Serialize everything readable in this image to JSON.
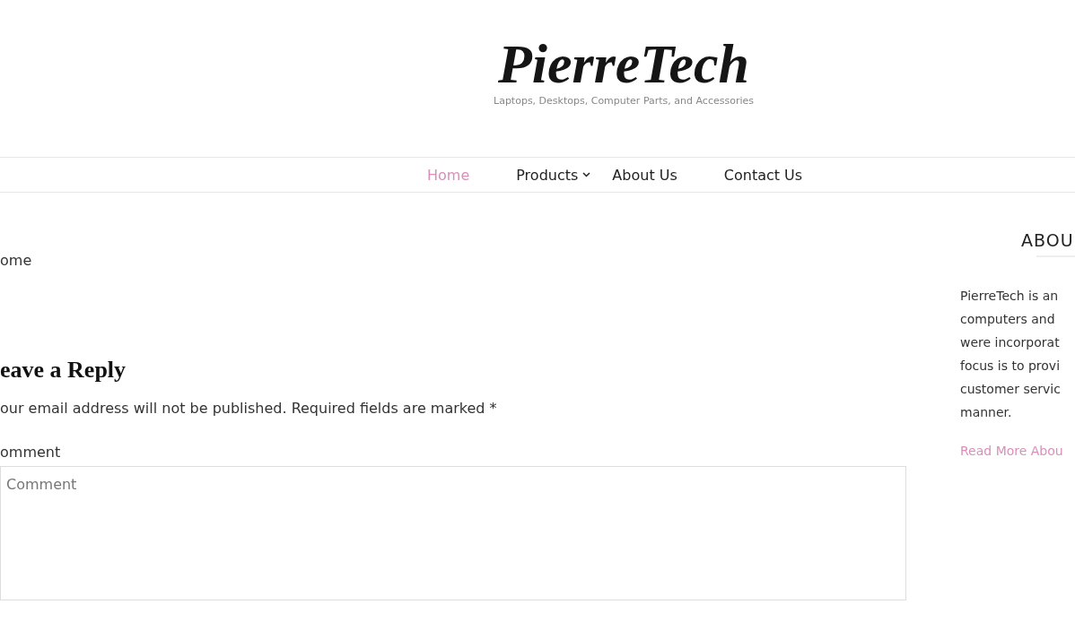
{
  "header": {
    "logo": "PierreTech",
    "tagline": "Laptops, Desktops, Computer Parts, and Accessories"
  },
  "nav": [
    {
      "label": "Home",
      "selected": true,
      "dropdown": false
    },
    {
      "label": "Products",
      "selected": false,
      "dropdown": true
    },
    {
      "label": "About Us",
      "selected": false,
      "dropdown": false
    },
    {
      "label": "Contact Us",
      "selected": false,
      "dropdown": false
    }
  ],
  "breadcrumb": "ome",
  "reply": {
    "title": "eave a Reply",
    "notice": "our email address will not be published. Required fields are marked *",
    "comment_label": "omment",
    "comment_placeholder": "Comment"
  },
  "sidebar": {
    "title": "ABOU",
    "text_lines": [
      "PierreTech is an",
      "computers and",
      "were incorporat",
      "focus is to provi",
      "customer servic",
      "manner."
    ],
    "link": "Read More Abou"
  }
}
